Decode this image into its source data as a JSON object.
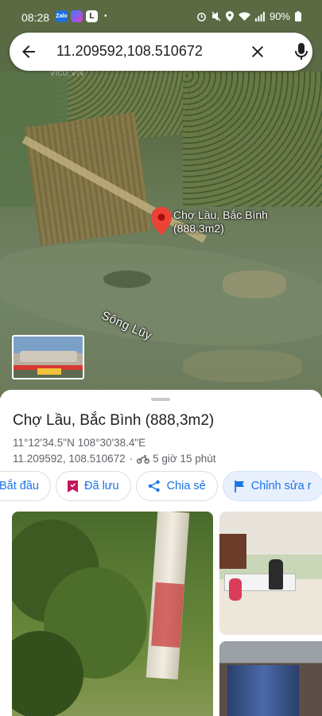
{
  "status_bar": {
    "time": "08:28",
    "battery": "90%",
    "app_icons": [
      {
        "name": "zalo-app-icon",
        "text": "Zalo",
        "color": "#1e6fe0"
      },
      {
        "name": "messenger-app-icon",
        "text": "",
        "color": "#a23ce0"
      },
      {
        "name": "l-app-icon",
        "text": "L",
        "color": "#ffffff"
      }
    ]
  },
  "search": {
    "query": "11.209592,108.510672"
  },
  "map": {
    "watermark": "Vico.VN",
    "river_label": "Sông Lũy",
    "pin_label": "Chợ Lầu, Bắc Bình (888,3m2)"
  },
  "place": {
    "title": "Chợ Lầu, Bắc Bình (888,3m2)",
    "dms": "11°12'34.5\"N 108°30'38.4\"E",
    "coordinates": "11.209592, 108.510672",
    "separator": "·",
    "travel_time": "5 giờ 15 phút"
  },
  "actions": {
    "start": "Bắt đầu",
    "saved": "Đã lưu",
    "share": "Chia sẻ",
    "edit": "Chỉnh sửa r"
  },
  "colors": {
    "accent": "#1a73e8",
    "pin": "#ea4335",
    "saved": "#c2185b"
  }
}
